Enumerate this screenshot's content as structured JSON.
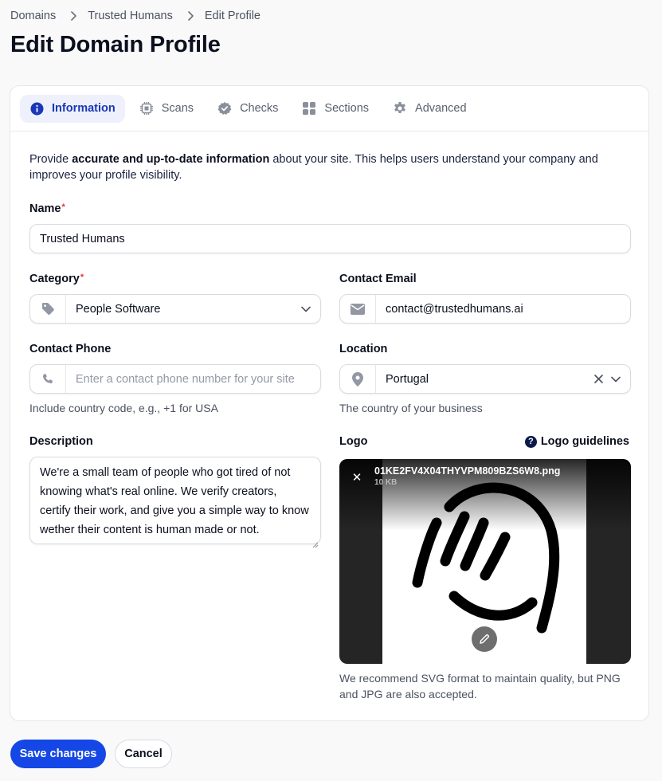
{
  "breadcrumb": {
    "items": [
      "Domains",
      "Trusted Humans",
      "Edit Profile"
    ]
  },
  "page": {
    "title": "Edit Domain Profile"
  },
  "tabs": [
    {
      "label": "Information",
      "icon": "info-icon",
      "active": true
    },
    {
      "label": "Scans",
      "icon": "chip-icon",
      "active": false
    },
    {
      "label": "Checks",
      "icon": "check-badge-icon",
      "active": false
    },
    {
      "label": "Sections",
      "icon": "grid-icon",
      "active": false
    },
    {
      "label": "Advanced",
      "icon": "gear-icon",
      "active": false
    }
  ],
  "intro": {
    "prefix": "Provide ",
    "bold": "accurate and up-to-date information",
    "suffix": " about your site. This helps users understand your company and improves your profile visibility."
  },
  "form": {
    "name": {
      "label": "Name",
      "required": "*",
      "value": "Trusted Humans"
    },
    "category": {
      "label": "Category",
      "required": "*",
      "value": "People Software",
      "icon": "tag-icon"
    },
    "contact_email": {
      "label": "Contact Email",
      "value": "contact@trustedhumans.ai",
      "icon": "envelope-icon"
    },
    "contact_phone": {
      "label": "Contact Phone",
      "placeholder": "Enter a contact phone number for your site",
      "hint": "Include country code, e.g., +1 for USA",
      "icon": "phone-icon"
    },
    "location": {
      "label": "Location",
      "value": "Portugal",
      "hint": "The country of your business",
      "icon": "map-pin-icon"
    },
    "description": {
      "label": "Description",
      "value": "We're a small team of people who got tired of not knowing what's real online. We verify creators, certify their work, and give you a simple way to know wether their content is human made or not."
    },
    "logo": {
      "label": "Logo",
      "guidelines_label": "Logo guidelines",
      "file_name": "01KE2FV4X04THYVPM809BZS6W8.png",
      "file_size": "10 KB",
      "hint": "We recommend SVG format to maintain quality, but PNG and JPG are also accepted."
    }
  },
  "actions": {
    "save_label": "Save changes",
    "cancel_label": "Cancel"
  },
  "colors": {
    "primary": "#1447e6",
    "tab_active_bg": "#eef1fb",
    "tab_active_text": "#1a37b8",
    "required": "#e0303a"
  }
}
